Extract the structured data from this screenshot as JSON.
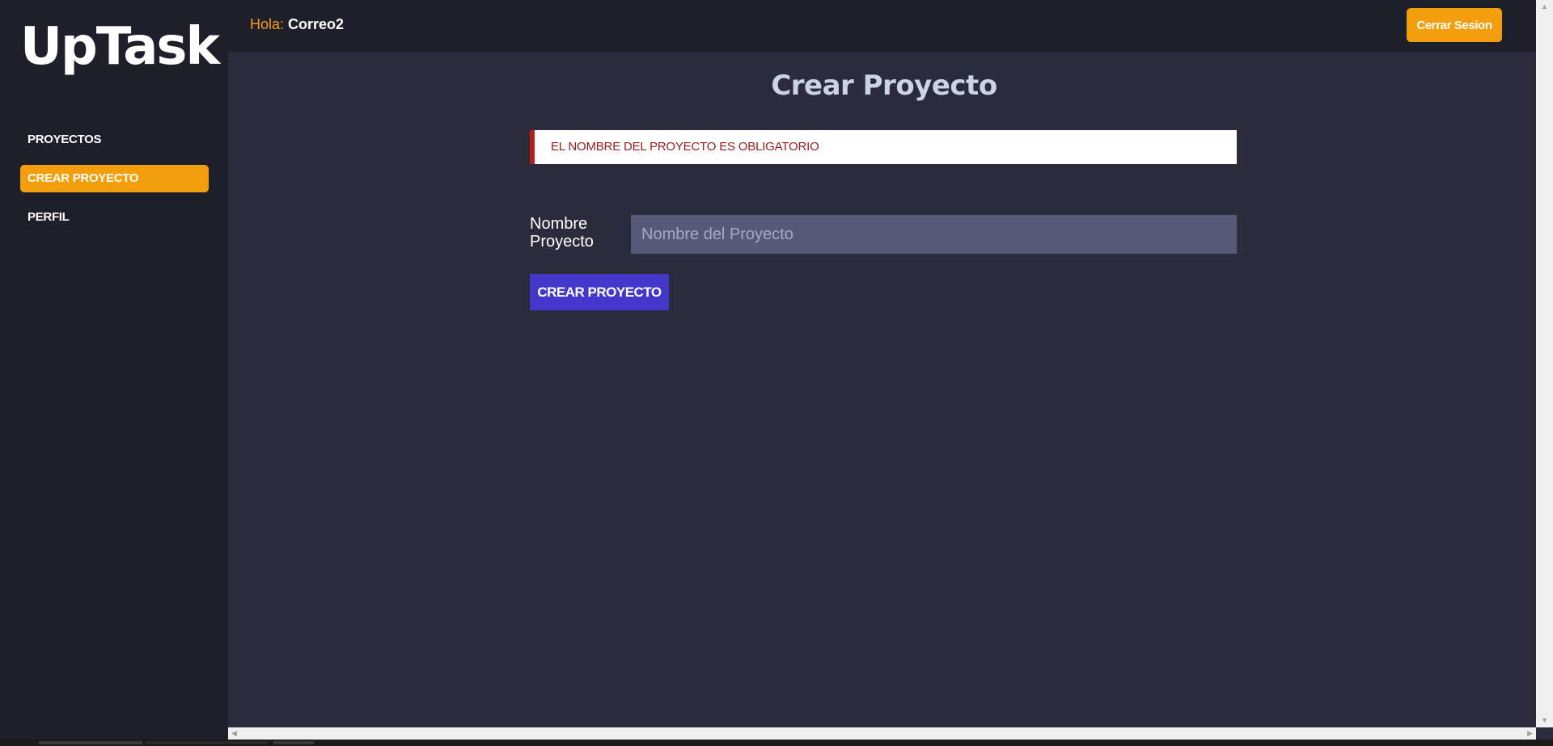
{
  "app": {
    "logo": "UpTask"
  },
  "sidebar": {
    "items": [
      {
        "label": "Proyectos",
        "active": false
      },
      {
        "label": "Crear Proyecto",
        "active": true
      },
      {
        "label": "Perfil",
        "active": false
      }
    ]
  },
  "topbar": {
    "greeting_prefix": "Hola:",
    "username": "Correo2",
    "logout_label": "Cerrar Sesion"
  },
  "main": {
    "title": "Crear Proyecto",
    "alert": {
      "type": "error",
      "message": "El nombre del proyecto es obligatorio"
    },
    "form": {
      "name_label": "Nombre Proyecto",
      "name_placeholder": "Nombre del Proyecto",
      "name_value": "",
      "submit_label": "Crear Proyecto"
    }
  },
  "colors": {
    "accent": "#f59e0b",
    "primary_button": "#4338ca",
    "background": "#2c2b3c",
    "sidebar": "#1f1f2b",
    "error": "#b91c1c"
  }
}
